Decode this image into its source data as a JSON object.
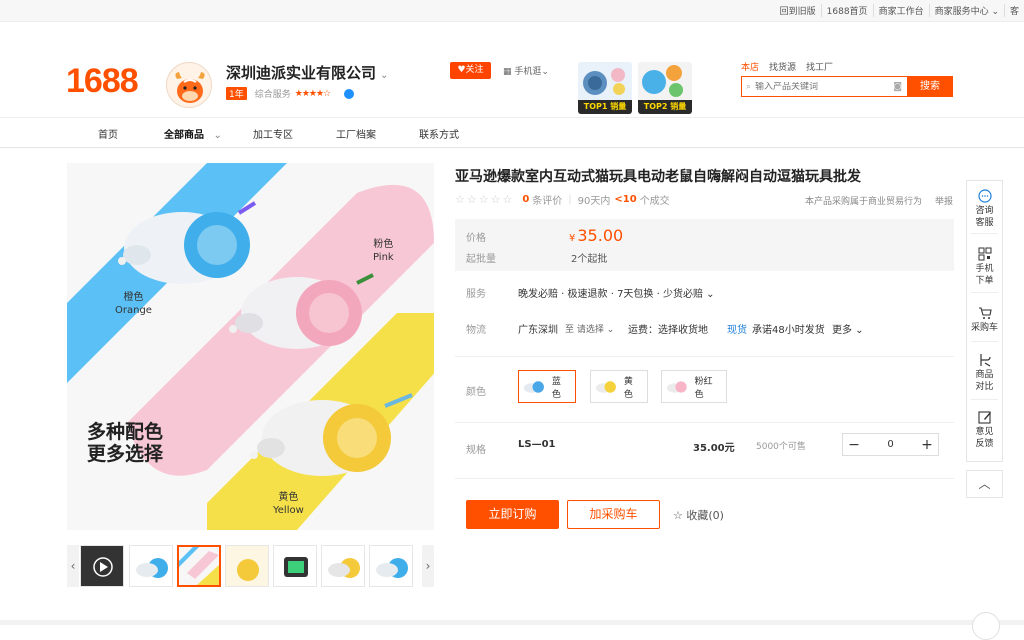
{
  "topbar": {
    "links": [
      "回到旧版",
      "1688首页",
      "商家工作台",
      "商家服务中心 ⌄",
      "客"
    ]
  },
  "header": {
    "logo": "1688",
    "company": "深圳迪派实业有限公司",
    "year_badge": "1年",
    "service_label": "综合服务",
    "stars": "★★★★☆",
    "follow": "♥关注",
    "mobile": "手机逛⌄",
    "top_thumbs": [
      {
        "label": "TOP1 销量"
      },
      {
        "label": "TOP2 销量"
      }
    ],
    "search_tabs": [
      "本店",
      "找货源",
      "找工厂"
    ],
    "search_placeholder": "输入产品关键词",
    "search_button": "搜索"
  },
  "nav": {
    "items": [
      "首页",
      "全部商品",
      "加工专区",
      "工厂档案",
      "联系方式"
    ]
  },
  "gallery": {
    "label_orange": "橙色",
    "label_orange_en": "Orange",
    "label_pink": "粉色",
    "label_pink_en": "Pink",
    "label_yellow": "黄色",
    "label_yellow_en": "Yellow",
    "slogan_line1": "多种配色",
    "slogan_line2": "更多选择"
  },
  "product": {
    "title": "亚马逊爆款室内互动式猫玩具电动老鼠自嗨解闷自动逗猫玩具批发",
    "reviews_count": "0",
    "reviews_label": "条评价",
    "sold_period": "90天内",
    "sold_count": "<10",
    "sold_label": "个成交",
    "trade_note": "本产品采购属于商业贸易行为",
    "report": "举报",
    "price_label": "价格",
    "price_currency": "¥",
    "price": "35.00",
    "moq_label": "起批量",
    "moq": "2个起批",
    "service_label": "服务",
    "service": "晚发必赔 · 极速退款 · 7天包换 · 少货必赔 ⌄",
    "logistics_label": "物流",
    "logistics_from": "广东深圳",
    "logistics_to": "至 请选择 ⌄",
    "shipping": "运费：选择收货地",
    "stock_tag": "现货",
    "ship_promise": "承诺48小时发货",
    "more": "更多 ⌄",
    "color_label": "颜色",
    "colors": [
      {
        "name": "蓝色",
        "hex": "#4aa8e8"
      },
      {
        "name": "黄色",
        "hex": "#f5d23b"
      },
      {
        "name": "粉红色",
        "hex": "#f7b5c7"
      }
    ],
    "spec_label": "规格",
    "spec_name": "LS—01",
    "spec_price": "35.00元",
    "spec_stock": "5000个可售",
    "qty": "0",
    "buy_now": "立即订购",
    "add_cart": "加采购车",
    "favorite": "☆ 收藏(0)"
  },
  "sidebar": {
    "items": [
      {
        "label": "咨询\n客服",
        "icon": "chat-icon"
      },
      {
        "label": "手机\n下单",
        "icon": "qrcode-icon"
      },
      {
        "label": "采购车",
        "icon": "cart-icon"
      },
      {
        "label": "商品\n对比",
        "icon": "compare-icon"
      },
      {
        "label": "意见\n反馈",
        "icon": "edit-icon"
      }
    ],
    "back_top": "︿"
  },
  "colors": {
    "brand": "#ff5000"
  }
}
